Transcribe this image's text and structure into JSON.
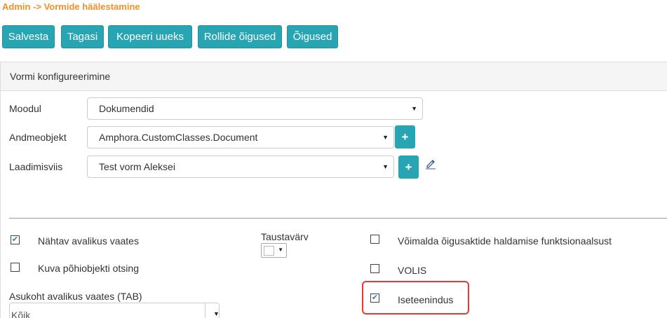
{
  "breadcrumb": "Admin -> Vormide häälestamine",
  "toolbar": {
    "save": "Salvesta",
    "back": "Tagasi",
    "copy_new": "Kopeeri uueks",
    "role_rights": "Rollide õigused",
    "rights": "Õigused"
  },
  "panel": {
    "title": "Vormi konfigureerimine"
  },
  "form": {
    "module": {
      "label": "Moodul",
      "value": "Dokumendid"
    },
    "data_object": {
      "label": "Andmeobjekt",
      "value": "Amphora.CustomClasses.Document",
      "add": "+"
    },
    "layout": {
      "label": "Laadimisviis",
      "value": "Test vorm Aleksei",
      "add": "+"
    }
  },
  "options": {
    "visible_public": {
      "label": "Nähtav avalikus vaates",
      "checked": true
    },
    "show_main_search": {
      "label": "Kuva põhiobjekti otsing",
      "checked": false
    },
    "background_color": {
      "label": "Taustavärv"
    },
    "enable_legal_acts": {
      "label": "Võimalda õigusaktide haldamise funktsionaalsust",
      "checked": false
    },
    "volis": {
      "label": "VOLIS",
      "checked": false
    },
    "self_service": {
      "label": "Iseteenindus",
      "checked": true
    },
    "tab_location": {
      "label": "Asukoht avalikus vaates (TAB)",
      "value": "Kõik"
    }
  },
  "icons": {
    "caret": "caret-down-icon",
    "edit": "pencil-icon",
    "check": "checkmark-icon"
  },
  "colors": {
    "accent": "#28a5b3",
    "breadcrumb": "#f0902a",
    "highlight": "#e53935"
  }
}
